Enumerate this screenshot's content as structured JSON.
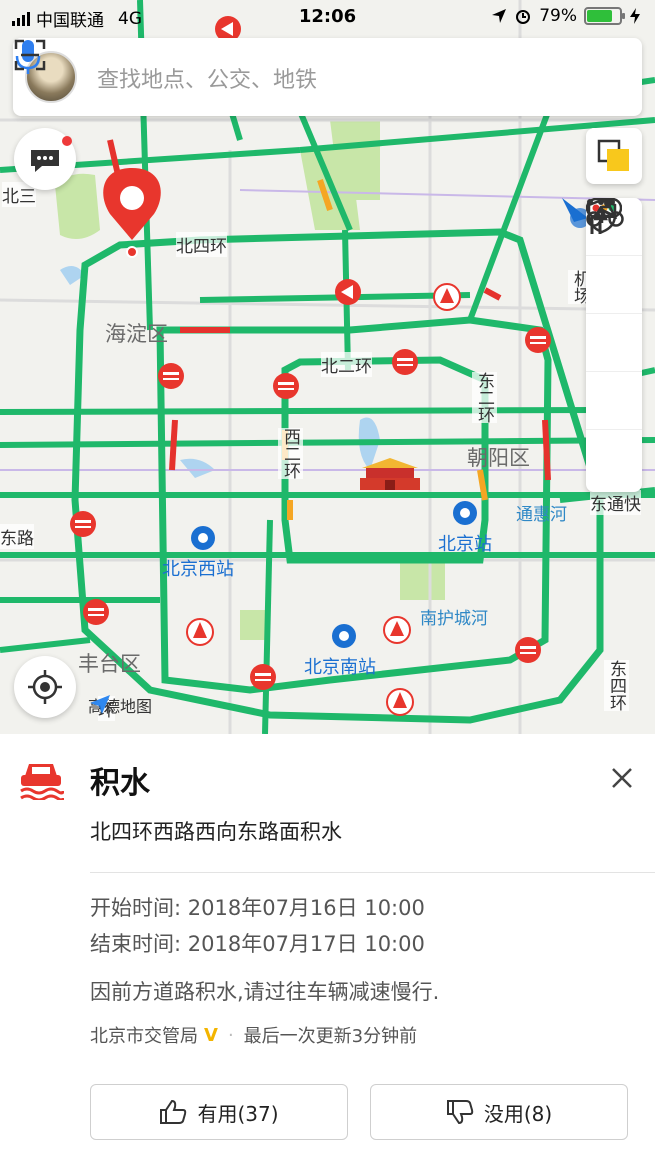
{
  "status_bar": {
    "carrier": "中国联通",
    "network": "4G",
    "time": "12:06",
    "battery": "79%",
    "battery_fraction": 0.79
  },
  "search": {
    "placeholder": "查找地点、公交、地铁"
  },
  "map": {
    "labels": {
      "beisihuan": "北四环",
      "haidian": "海淀区",
      "beierhuan": "北二环",
      "xierhuan": "西二环",
      "dongerhuan": "东二环",
      "chaoyang": "朝阳区",
      "tonghuihe": "通惠河",
      "dongtong": "东通快",
      "beijing_west": "北京西站",
      "beijing_station": "北京站",
      "nanhuchenghe": "南护城河",
      "beijing_south": "北京南站",
      "fengtai": "丰台区",
      "jichang": "机场",
      "dongsihuan": "东四环",
      "bei_edge": "北三",
      "lu_edge": "东路",
      "huan_edge": "环"
    },
    "logo_text": "高德地图",
    "colors": {
      "road_green": "#1fb86a",
      "road_red": "#e5322d",
      "road_orange": "#f5a623",
      "pin_red": "#e8362d",
      "park_green": "#c8e6a8",
      "water": "#aed4f0"
    }
  },
  "icons": {
    "message": "message-icon",
    "layers": "layers-icon",
    "traffic": "traffic-light-icon",
    "walk": "walking-icon",
    "bike": "bike-icon",
    "safety": "shield-icon",
    "more": "more-icon",
    "locate": "locate-icon",
    "mic": "mic-icon",
    "scan": "scan-icon",
    "flood": "flood-icon",
    "close": "close-icon",
    "thumbs_up": "thumbs-up-icon",
    "thumbs_down": "thumbs-down-icon"
  },
  "event": {
    "title": "积水",
    "description": "北四环西路西向东路面积水",
    "start_label": "开始时间:",
    "start_value": "2018年07月16日 10:00",
    "end_label": "结束时间:",
    "end_value": "2018年07月17日 10:00",
    "notice": "因前方道路积水,请过往车辆减速慢行.",
    "source": "北京市交管局",
    "verified_badge": "V",
    "updated": "最后一次更新3分钟前",
    "useful_label": "有用(37)",
    "useless_label": "没用(8)"
  }
}
